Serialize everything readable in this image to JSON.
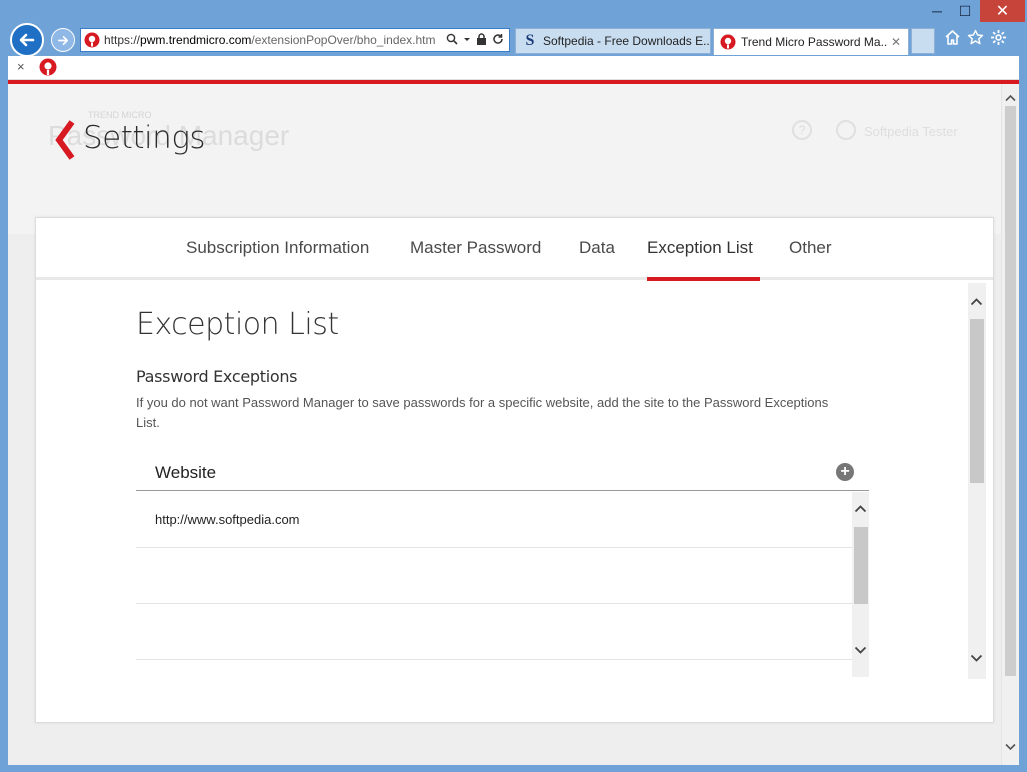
{
  "window": {
    "minimize": "─",
    "maximize": "☐",
    "close": "✕"
  },
  "nav": {
    "back_icon": "arrow-left-icon",
    "forward_icon": "arrow-right-icon"
  },
  "address_bar": {
    "url_prefix": "https://",
    "url_host": "pwm.trendmicro.com",
    "url_path": "/extensionPopOver/bho_index.htm"
  },
  "tabs": [
    {
      "title": "Softpedia - Free Downloads E...",
      "icon": "S"
    },
    {
      "title": "Trend Micro Password Ma...",
      "close": "✕"
    }
  ],
  "toolbar": {
    "close": "×"
  },
  "ghost_header": {
    "brand": "TREND MICRO",
    "title": "Password Manager",
    "help": "?",
    "user": "Softpedia Tester"
  },
  "header": {
    "title": "Settings"
  },
  "settings_tabs": [
    "Subscription Information",
    "Master Password",
    "Data",
    "Exception List",
    "Other"
  ],
  "active_tab": "Exception List",
  "content": {
    "title": "Exception List",
    "section_title": "Password Exceptions",
    "section_desc": "If you do not want Password Manager to save passwords for a specific website, add the site to the Password Exceptions List.",
    "table": {
      "column": "Website",
      "add": "+",
      "rows": [
        "http://www.softpedia.com",
        "",
        ""
      ]
    }
  },
  "colors": {
    "accent": "#d71921",
    "ie_frame": "#6fa3d8"
  }
}
